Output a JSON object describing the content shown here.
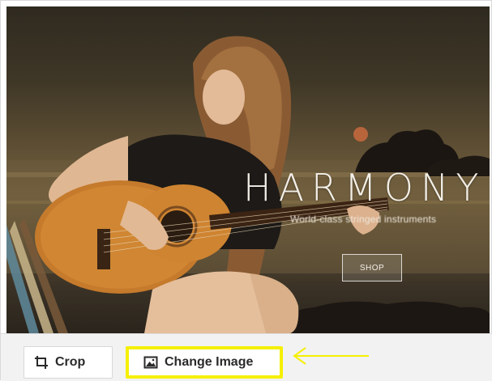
{
  "preview": {
    "hero_title": "HARMONY",
    "hero_subtitle": "World-class stringed instruments",
    "hero_button": "SHOP"
  },
  "toolbar": {
    "crop_label": "Crop",
    "change_image_label": "Change Image",
    "crop_icon": "crop-icon",
    "change_image_icon": "image-icon"
  },
  "annotation": {
    "highlight_color": "#f5f000",
    "arrow_icon": "left-arrow-icon"
  }
}
